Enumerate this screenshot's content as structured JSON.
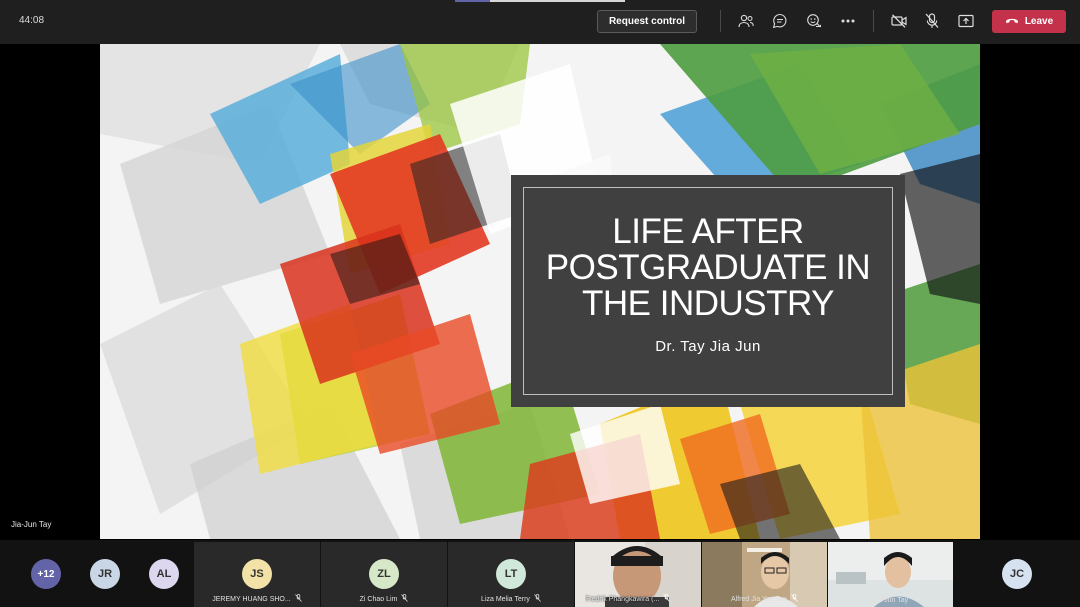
{
  "topbar": {
    "timer": "44:08",
    "request_control": "Request control",
    "leave": "Leave",
    "icons": [
      "people-icon",
      "chat-icon",
      "reactions-icon",
      "more-icon",
      "camera-off-icon",
      "mic-off-icon",
      "share-tray-icon",
      "phone-hangup-icon"
    ],
    "colors": {
      "leave": "#c4314b",
      "accent": "#6264a7"
    }
  },
  "stage": {
    "presenter_name": "Jia-Jun Tay",
    "slide": {
      "title": "LIFE AFTER POSTGRADUATE IN THE INDUSTRY",
      "title_lines": [
        "LIFE AFTER",
        "POSTGRADUATE IN",
        "THE INDUSTRY"
      ],
      "subtitle": "Dr. Tay Jia Jun"
    }
  },
  "participants": {
    "overflow": "+12",
    "avatars": [
      {
        "initials": "JR"
      },
      {
        "initials": "AL"
      }
    ],
    "tiles": [
      {
        "initials": "JS",
        "name": "JEREMY HUANG SHO...",
        "muted": true
      },
      {
        "initials": "ZL",
        "name": "Zi Chao Lim",
        "muted": true
      },
      {
        "initials": "LT",
        "name": "Liza Melia Terry",
        "muted": true
      }
    ],
    "videos": [
      {
        "name": "Fredrik Phangkawira (...",
        "muted": true
      },
      {
        "name": "Alfred Jia Yee Tan",
        "muted": true
      },
      {
        "name": "Jia-Jun Tay",
        "muted": false
      }
    ],
    "last": {
      "initials": "JC"
    }
  }
}
